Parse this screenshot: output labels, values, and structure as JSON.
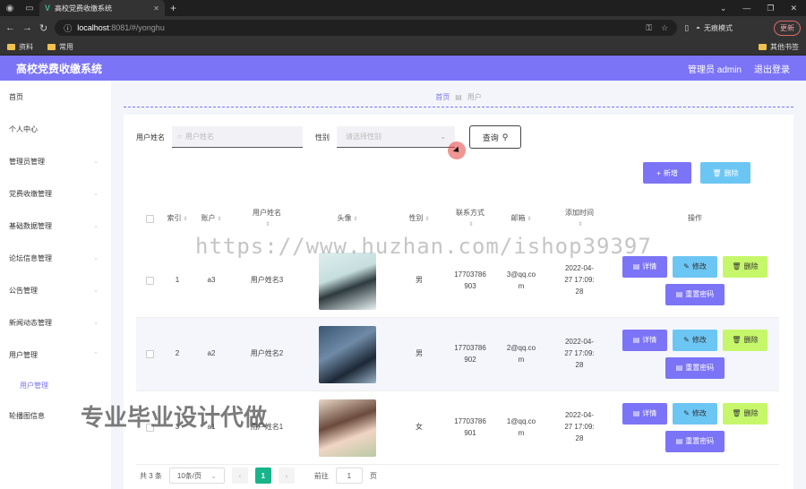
{
  "browser": {
    "tab_title": "高校党费收缴系统",
    "tab_logo": "V",
    "url_host": "localhost",
    "url_path": ":8081/#/yonghu",
    "incognito_label": "无痕模式",
    "update_label": "更新",
    "bookmarks": [
      "资料",
      "常用"
    ],
    "bookmarks_right": "其他书签"
  },
  "header": {
    "title": "高校党费收缴系统",
    "admin": "管理员 admin",
    "logout": "退出登录"
  },
  "sidebar": {
    "items": [
      {
        "label": "首页"
      },
      {
        "label": "个人中心"
      },
      {
        "label": "管理员管理"
      },
      {
        "label": "党费收缴管理"
      },
      {
        "label": "基础数据管理"
      },
      {
        "label": "论坛信息管理"
      },
      {
        "label": "公告管理"
      },
      {
        "label": "新闻动态管理"
      },
      {
        "label": "用户管理"
      }
    ],
    "sub_item": "用户管理",
    "last_item": "轮播图信息"
  },
  "breadcrumb": {
    "home": "首页",
    "current": "用户"
  },
  "search": {
    "name_label": "用户姓名",
    "name_placeholder": "用户姓名",
    "sex_label": "性别",
    "sex_placeholder": "请选择性别",
    "query_label": "查询"
  },
  "actions": {
    "add": "新增",
    "delete": "删除"
  },
  "table": {
    "headers": {
      "index": "索引",
      "account": "账户",
      "name": "用户姓名",
      "avatar": "头像",
      "sex": "性别",
      "phone": "联系方式",
      "email": "邮箱",
      "time": "添加时间",
      "ops": "操作"
    },
    "rows": [
      {
        "index": "1",
        "account": "a3",
        "name": "用户姓名3",
        "sex": "男",
        "phone1": "17703786",
        "phone2": "903",
        "email1": "3@qq.co",
        "email2": "m",
        "time1": "2022-04-",
        "time2": "27 17:09:",
        "time3": "28"
      },
      {
        "index": "2",
        "account": "a2",
        "name": "用户姓名2",
        "sex": "男",
        "phone1": "17703786",
        "phone2": "902",
        "email1": "2@qq.co",
        "email2": "m",
        "time1": "2022-04-",
        "time2": "27 17:09:",
        "time3": "28"
      },
      {
        "index": "3",
        "account": "a1",
        "name": "用户姓名1",
        "sex": "女",
        "phone1": "17703786",
        "phone2": "901",
        "email1": "1@qq.co",
        "email2": "m",
        "time1": "2022-04-",
        "time2": "27 17:09:",
        "time3": "28"
      }
    ],
    "op_labels": {
      "detail": "详情",
      "edit": "修改",
      "delete": "删除",
      "reset": "重置密码"
    }
  },
  "pager": {
    "total": "共 3 条",
    "size": "10条/页",
    "current": "1",
    "goto": "前往",
    "goto_value": "1",
    "page_unit": "页"
  },
  "watermarks": {
    "url": "https://www.huzhan.com/ishop39397",
    "text": "专业毕业设计代做"
  },
  "colors": {
    "accent": "#7c74f6",
    "info": "#6cc6f4",
    "lime": "#c6f76b",
    "page_active": "#18b48a"
  }
}
